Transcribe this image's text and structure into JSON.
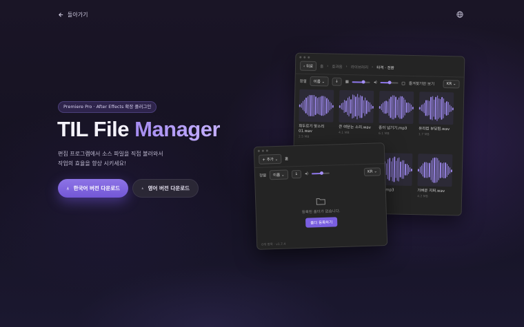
{
  "nav": {
    "back_label": "돌아가기"
  },
  "hero": {
    "badge": "Premiere Pro · After Effects 확장 플러그인",
    "title_part1": "TIL File ",
    "title_part2": "Manager",
    "desc_line1": "편집 프로그램에서 소스 파일을 직접 불러와서",
    "desc_line2": "작업의 효율을 향상 시키세요!",
    "btn_korean": "한국어 버전 다운로드",
    "btn_english": "영어 버전 다운로드"
  },
  "window_a": {
    "back_label": "뒤로",
    "breadcrumb": [
      "홈",
      "효과음",
      "라이브러리",
      "타격 · 전환"
    ],
    "sort_label": "정렬",
    "sort_value": "이름",
    "checkbox_label": "즐겨찾기만 보기",
    "lang": "KR",
    "cards": [
      {
        "name": "휘두르기 맞소리 01.wav",
        "size": "2.5 MB"
      },
      {
        "name": "큰 여닫는 소리.wav",
        "size": "4.1 MB"
      },
      {
        "name": "종이 넘기기.mp3",
        "size": "6.1 MB"
      },
      {
        "name": "유리컵 부딪힘.wav",
        "size": "1.7 MB"
      },
      {
        "name": "",
        "size": ""
      },
      {
        "name": "",
        "size": ""
      },
      {
        "name": "효과.mp3",
        "size": ""
      },
      {
        "name": "가벼운 지퍼.wav",
        "size": "4.2 MB"
      }
    ]
  },
  "window_b": {
    "add_label": "+ 추가",
    "home_label": "홈",
    "sort_label": "정렬",
    "sort_value": "이름",
    "lang": "KR",
    "empty_text": "등록된 폴더가 없습니다.",
    "register_label": "폴더 등록하기",
    "status": "0개 항목 · v1.7.4"
  },
  "colors": {
    "accent": "#7a5fe0",
    "accent_light": "#a58cf0",
    "background": "#17131f"
  }
}
